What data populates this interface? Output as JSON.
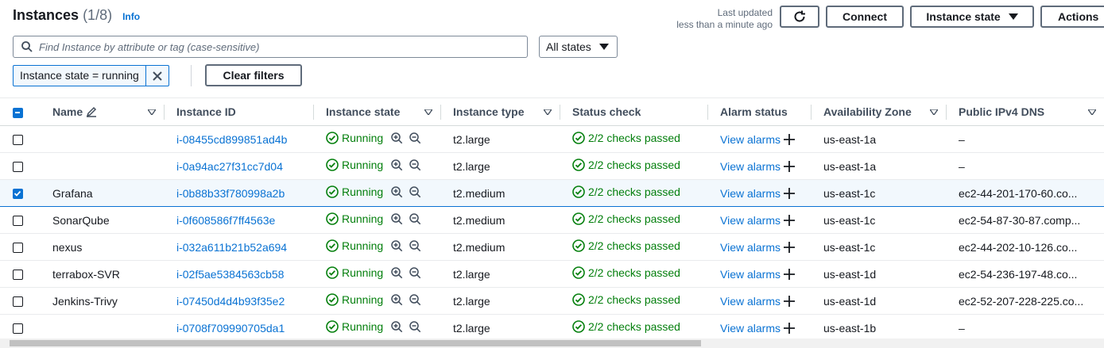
{
  "header": {
    "title": "Instances",
    "count": "(1/8)",
    "info": "Info",
    "last_updated_line1": "Last updated",
    "last_updated_line2": "less than a minute ago"
  },
  "buttons": {
    "connect": "Connect",
    "instance_state": "Instance state",
    "actions": "Actions"
  },
  "search": {
    "placeholder": "Find Instance by attribute or tag (case-sensitive)"
  },
  "state_filter": {
    "selected": "All states"
  },
  "filter_token": {
    "label": "Instance state = running"
  },
  "clear_filters": "Clear filters",
  "columns": {
    "name": "Name",
    "instance_id": "Instance ID",
    "instance_state": "Instance state",
    "instance_type": "Instance type",
    "status_check": "Status check",
    "alarm_status": "Alarm status",
    "availability_zone": "Availability Zone",
    "public_dns": "Public IPv4 DNS"
  },
  "rows": [
    {
      "name": "",
      "id": "i-08455cd899851ad4b",
      "state": "Running",
      "type": "t2.large",
      "status": "2/2 checks passed",
      "alarm": "View alarms",
      "az": "us-east-1a",
      "dns": "–",
      "selected": false
    },
    {
      "name": "",
      "id": "i-0a94ac27f31cc7d04",
      "state": "Running",
      "type": "t2.large",
      "status": "2/2 checks passed",
      "alarm": "View alarms",
      "az": "us-east-1a",
      "dns": "–",
      "selected": false
    },
    {
      "name": "Grafana",
      "id": "i-0b88b33f780998a2b",
      "state": "Running",
      "type": "t2.medium",
      "status": "2/2 checks passed",
      "alarm": "View alarms",
      "az": "us-east-1c",
      "dns": "ec2-44-201-170-60.co...",
      "selected": true
    },
    {
      "name": "SonarQube",
      "id": "i-0f608586f7ff4563e",
      "state": "Running",
      "type": "t2.medium",
      "status": "2/2 checks passed",
      "alarm": "View alarms",
      "az": "us-east-1c",
      "dns": "ec2-54-87-30-87.comp...",
      "selected": false
    },
    {
      "name": "nexus",
      "id": "i-032a611b21b52a694",
      "state": "Running",
      "type": "t2.medium",
      "status": "2/2 checks passed",
      "alarm": "View alarms",
      "az": "us-east-1c",
      "dns": "ec2-44-202-10-126.co...",
      "selected": false
    },
    {
      "name": "terrabox-SVR",
      "id": "i-02f5ae5384563cb58",
      "state": "Running",
      "type": "t2.large",
      "status": "2/2 checks passed",
      "alarm": "View alarms",
      "az": "us-east-1d",
      "dns": "ec2-54-236-197-48.co...",
      "selected": false
    },
    {
      "name": "Jenkins-Trivy",
      "id": "i-07450d4d4b93f35e2",
      "state": "Running",
      "type": "t2.large",
      "status": "2/2 checks passed",
      "alarm": "View alarms",
      "az": "us-east-1d",
      "dns": "ec2-52-207-228-225.co...",
      "selected": false
    },
    {
      "name": "",
      "id": "i-0708f709990705da1",
      "state": "Running",
      "type": "t2.large",
      "status": "2/2 checks passed",
      "alarm": "View alarms",
      "az": "us-east-1b",
      "dns": "–",
      "selected": false
    }
  ],
  "colors": {
    "link": "#0972d3",
    "success": "#037f0c",
    "selected_bg": "#f2f8fd"
  }
}
